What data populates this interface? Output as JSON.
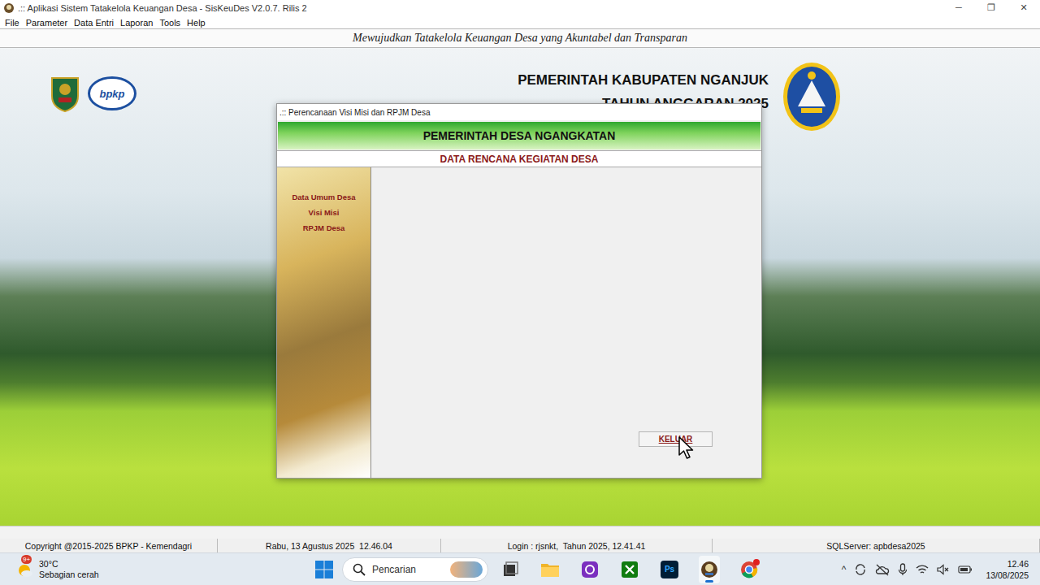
{
  "window": {
    "title": ".:: Aplikasi Sistem Tatakelola Keuangan Desa - SisKeuDes V2.0.7. Rilis 2",
    "controls": [
      "─",
      "❐",
      "✕"
    ]
  },
  "menu": [
    "File",
    "Parameter",
    "Data Entri",
    "Laporan",
    "Tools",
    "Help"
  ],
  "banner": "Mewujudkan Tatakelola Keuangan Desa yang Akuntabel dan Transparan",
  "header": {
    "logo_text": "bpkp",
    "title": "PEMERINTAH KABUPATEN NGANJUK",
    "subtitle": "TAHUN ANGGARAN 2025"
  },
  "dialog": {
    "title": ".:: Perencanaan Visi Misi dan RPJM Desa",
    "header": "PEMERINTAH DESA NGANGKATAN",
    "subheader": "DATA RENCANA KEGIATAN DESA",
    "nav": [
      {
        "label": "Data Umum Desa",
        "selected": false
      },
      {
        "label": "Visi Misi",
        "selected": false
      },
      {
        "label": "RPJM Desa",
        "selected": false
      }
    ],
    "buttons": [
      "KELUAR"
    ]
  },
  "status_bar": [
    "Copyright @2015-2025 BPKP - Kemendagri",
    "Rabu, 13 Agustus 2025  12.46.04",
    "Login : rjsnkt,  Tahun 2025, 12.41.41",
    "SQLServer: apbdesa2025"
  ],
  "taskbar": {
    "weather": {
      "badge": "9+",
      "temp": "30°C",
      "desc": "Sebagian cerah"
    },
    "search": {
      "placeholder": "Pencarian"
    },
    "apps": [
      {
        "kind": "task-view",
        "active": false,
        "notified": false,
        "label": ""
      },
      {
        "kind": "folder",
        "active": false,
        "notified": false,
        "label": ""
      },
      {
        "kind": "purple-app",
        "active": false,
        "notified": false,
        "label": ""
      },
      {
        "kind": "xbox",
        "active": false,
        "notified": false,
        "label": ""
      },
      {
        "kind": "photoshop",
        "active": false,
        "notified": false,
        "label": "Ps"
      },
      {
        "kind": "siskeudes",
        "active": true,
        "notified": false,
        "label": ""
      },
      {
        "kind": "chrome",
        "active": false,
        "notified": true,
        "label": ""
      }
    ],
    "tray": {
      "expand": "^",
      "time": "12.46",
      "date": "13/08/2025"
    }
  }
}
